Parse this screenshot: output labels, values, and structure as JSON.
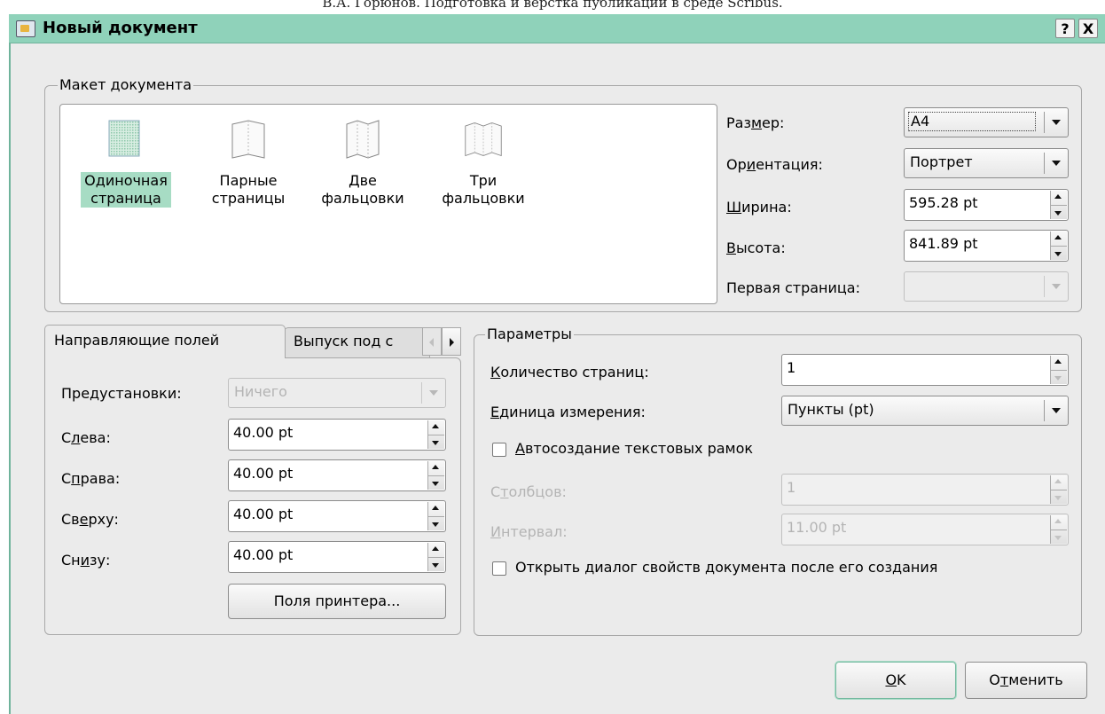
{
  "caption": "В.А. Горюнов. Подготовка и верстка публикаций в среде Scribus.",
  "window": {
    "title": "Новый документ",
    "help_label": "?",
    "close_label": "X"
  },
  "layout_group": {
    "legend": "Макет документа",
    "options": [
      {
        "line1": "Одиночная",
        "line2": "страница",
        "selected": true
      },
      {
        "line1": "Парные",
        "line2": "страницы",
        "selected": false
      },
      {
        "line1": "Две",
        "line2": "фальцовки",
        "selected": false
      },
      {
        "line1": "Три",
        "line2": "фальцовки",
        "selected": false
      }
    ],
    "size": {
      "pre": "Раз",
      "acc": "м",
      "post": "ер:",
      "value": "A4"
    },
    "orientation": {
      "pre": "Ор",
      "acc": "и",
      "post": "ентация:",
      "value": "Портрет"
    },
    "width": {
      "pre": "",
      "acc": "Ш",
      "post": "ирина:",
      "value": "595.28 pt"
    },
    "height": {
      "pre": "",
      "acc": "В",
      "post": "ысота:",
      "value": "841.89 pt"
    },
    "first_page": {
      "label": "Первая страница:",
      "value": ""
    }
  },
  "tabs": {
    "tab1": "Направляющие полей",
    "tab2": "Выпуск под с"
  },
  "margins": {
    "presets": {
      "label": "Предустановки:",
      "value": "Ничего"
    },
    "left": {
      "pre": "С",
      "acc": "л",
      "post": "ева:",
      "value": "40.00 pt"
    },
    "right": {
      "pre": "С",
      "acc": "п",
      "post": "рава:",
      "value": "40.00 pt"
    },
    "top": {
      "pre": "Св",
      "acc": "е",
      "post": "рху:",
      "value": "40.00 pt"
    },
    "bottom": {
      "pre": "Сн",
      "acc": "и",
      "post": "зу:",
      "value": "40.00 pt"
    },
    "printer_button": "Поля принтера..."
  },
  "params": {
    "legend": "Параметры",
    "page_count": {
      "pre": "",
      "acc": "К",
      "post": "оличество страниц:",
      "value": "1"
    },
    "unit": {
      "pre": "",
      "acc": "Е",
      "post": "диница измерения:",
      "value": "Пункты (pt)"
    },
    "auto_frames": {
      "pre": "",
      "acc": "А",
      "post": "втосоздание текстовых рамок",
      "checked": false
    },
    "columns": {
      "pre": "С",
      "acc": "т",
      "post": "олбцов:",
      "value": "1"
    },
    "gap": {
      "pre": "",
      "acc": "И",
      "post": "нтервал:",
      "value": "11.00 pt"
    },
    "open_props": {
      "label": "Открыть диалог свойств документа после его создания",
      "checked": false
    }
  },
  "buttons": {
    "ok": {
      "pre": "",
      "acc": "O",
      "post": "K"
    },
    "cancel": {
      "pre": "О",
      "acc": "т",
      "post": "менить"
    }
  },
  "colors": {
    "titlebar": "#8fd2ba",
    "selection": "#a7dcc4",
    "dialog_bg": "#ebebeb"
  }
}
